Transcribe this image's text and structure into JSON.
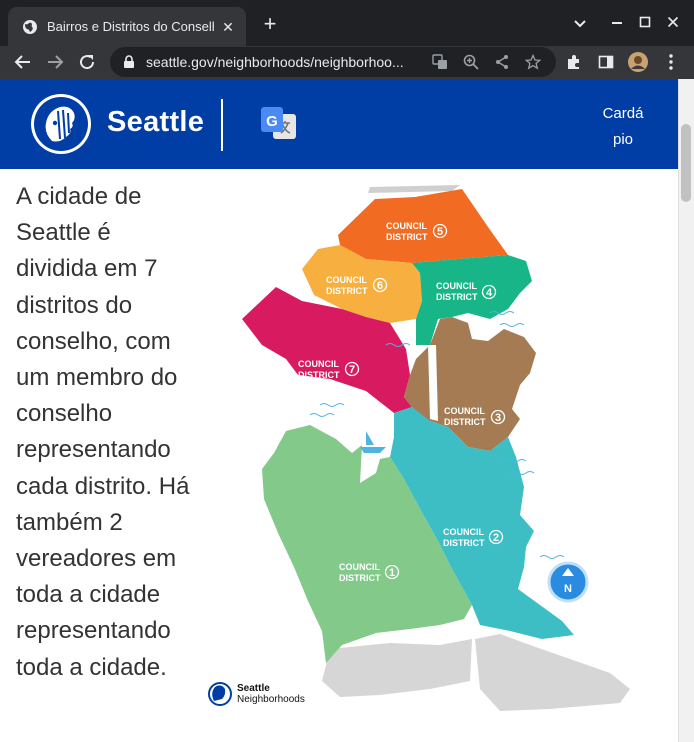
{
  "browser": {
    "tab_title": "Bairros e Distritos do Conselho",
    "url": "seattle.gov/neighborhoods/neighborhoo...",
    "new_tab_symbol": "+",
    "close_symbol": "✕"
  },
  "header": {
    "brand": "Seattle",
    "menu_label": "Cardápio",
    "menu_line1": "Cardá",
    "menu_line2": "pio",
    "bg_color": "#003da5"
  },
  "main": {
    "description": "A cidade de Seattle é dividida em 7 distritos do conselho, com um membro do conselho representando cada distrito. Há também 2 vereadores em toda a cidade representando toda a cidade."
  },
  "map": {
    "district_word": "COUNCIL",
    "district_word2": "DISTRICT",
    "districts": [
      {
        "number": "1",
        "color": "#82c98a"
      },
      {
        "number": "2",
        "color": "#3dbec5"
      },
      {
        "number": "3",
        "color": "#a57b54"
      },
      {
        "number": "4",
        "color": "#17b587"
      },
      {
        "number": "5",
        "color": "#f26b22"
      },
      {
        "number": "6",
        "color": "#f7b03f"
      },
      {
        "number": "7",
        "color": "#d81b60"
      }
    ],
    "north_symbol": "N",
    "logo_line1": "Seattle",
    "logo_line2": "Neighborhoods"
  }
}
